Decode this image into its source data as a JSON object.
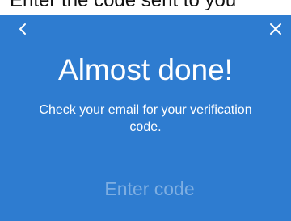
{
  "header": {
    "overlay_text": "Enter the code sent to you",
    "back_icon": "chevron-left-icon",
    "close_icon": "close-icon"
  },
  "main": {
    "title": "Almost done!",
    "subtitle": "Check your email for your verification code.",
    "code_input": {
      "placeholder": "Enter code",
      "value": ""
    }
  },
  "colors": {
    "background": "#2e7cd0",
    "text": "#ffffff"
  }
}
